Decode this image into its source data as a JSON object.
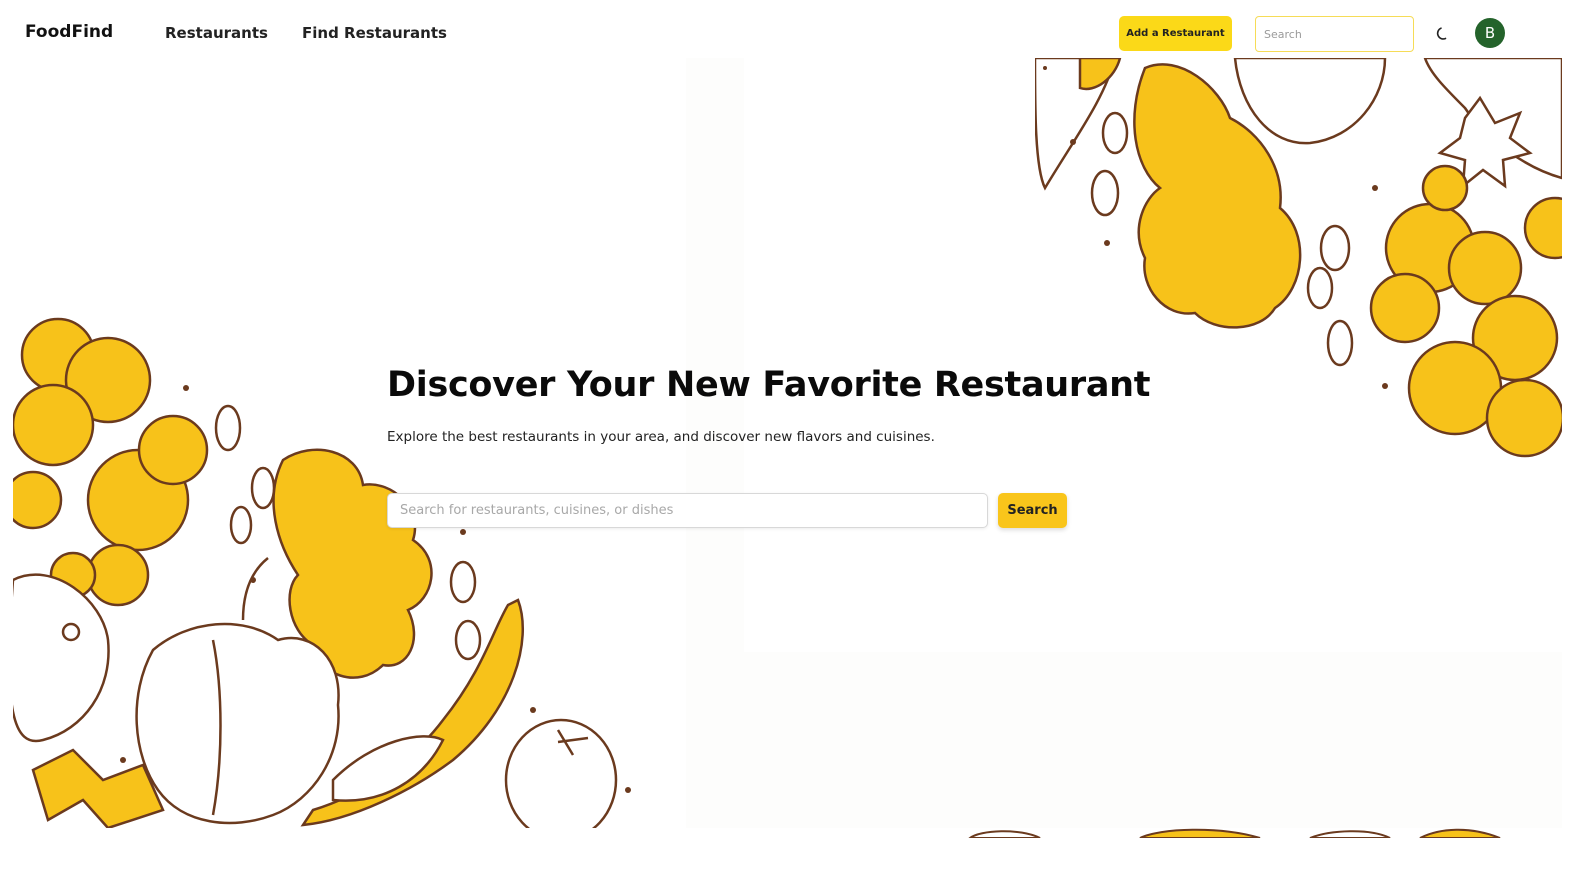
{
  "navbar": {
    "brand": "FoodFind",
    "links": [
      {
        "label": "Restaurants"
      },
      {
        "label": "Find Restaurants"
      }
    ],
    "add_button": "Add a Restaurant",
    "search_placeholder": "Search",
    "theme_toggle_icon": "moon-icon",
    "avatar_initial": "B",
    "avatar_color": "#24632b"
  },
  "hero": {
    "title": "Discover Your New Favorite Restaurant",
    "subtitle": "Explore the best restaurants in your area, and discover new flavors and cuisines.",
    "search_placeholder": "Search for restaurants, cuisines, or dishes",
    "search_button": "Search"
  },
  "colors": {
    "accent": "#fbd918",
    "search_button": "#f9c51b",
    "illustration_yellow": "#f7c21a",
    "illustration_outline": "#6b3a1e"
  }
}
